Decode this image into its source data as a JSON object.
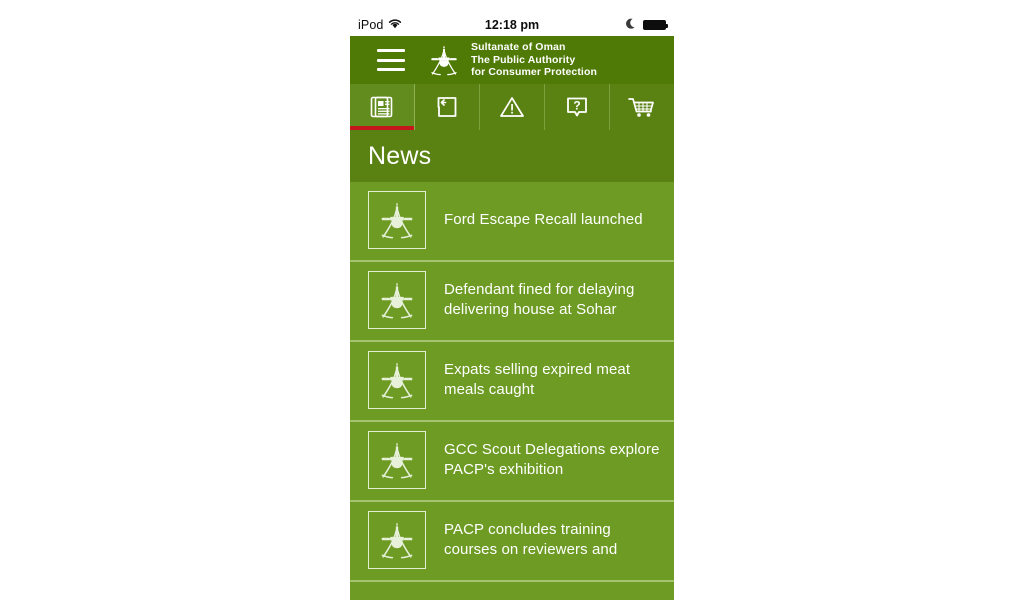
{
  "status_bar": {
    "carrier": "iPod",
    "wifi_icon": "wifi-icon",
    "time": "12:18 pm",
    "moon_icon": "moon-icon",
    "battery_icon": "battery-full-icon"
  },
  "header": {
    "menu_icon": "hamburger-menu-icon",
    "emblem_icon": "oman-national-emblem-icon",
    "brand_line1": "Sultanate of Oman",
    "brand_line2": "The Public Authority",
    "brand_line3": "for Consumer Protection"
  },
  "tabs": [
    {
      "name": "news",
      "icon": "newspaper-icon",
      "active": true
    },
    {
      "name": "complaint",
      "icon": "submit-complaint-icon",
      "active": false
    },
    {
      "name": "alerts",
      "icon": "warning-triangle-icon",
      "active": false
    },
    {
      "name": "faq",
      "icon": "question-bubble-icon",
      "active": false
    },
    {
      "name": "market",
      "icon": "shopping-cart-icon",
      "active": false
    }
  ],
  "section": {
    "title": "News"
  },
  "news": [
    {
      "thumb": "oman-national-emblem-icon",
      "title": "Ford Escape Recall launched"
    },
    {
      "thumb": "oman-national-emblem-icon",
      "title": "Defendant fined for delaying delivering house at Sohar"
    },
    {
      "thumb": "oman-national-emblem-icon",
      "title": "Expats selling expired meat meals caught"
    },
    {
      "thumb": "oman-national-emblem-icon",
      "title": "GCC Scout Delegations explore PACP's exhibition"
    },
    {
      "thumb": "oman-national-emblem-icon",
      "title": "PACP concludes training courses on reviewers and"
    }
  ],
  "colors": {
    "header_green": "#4f7a06",
    "tabbar_green": "#5a8213",
    "active_tab_green": "#628c1e",
    "list_green": "#6d9b24",
    "accent_red": "#c4161c",
    "text_white": "#ffffff"
  }
}
